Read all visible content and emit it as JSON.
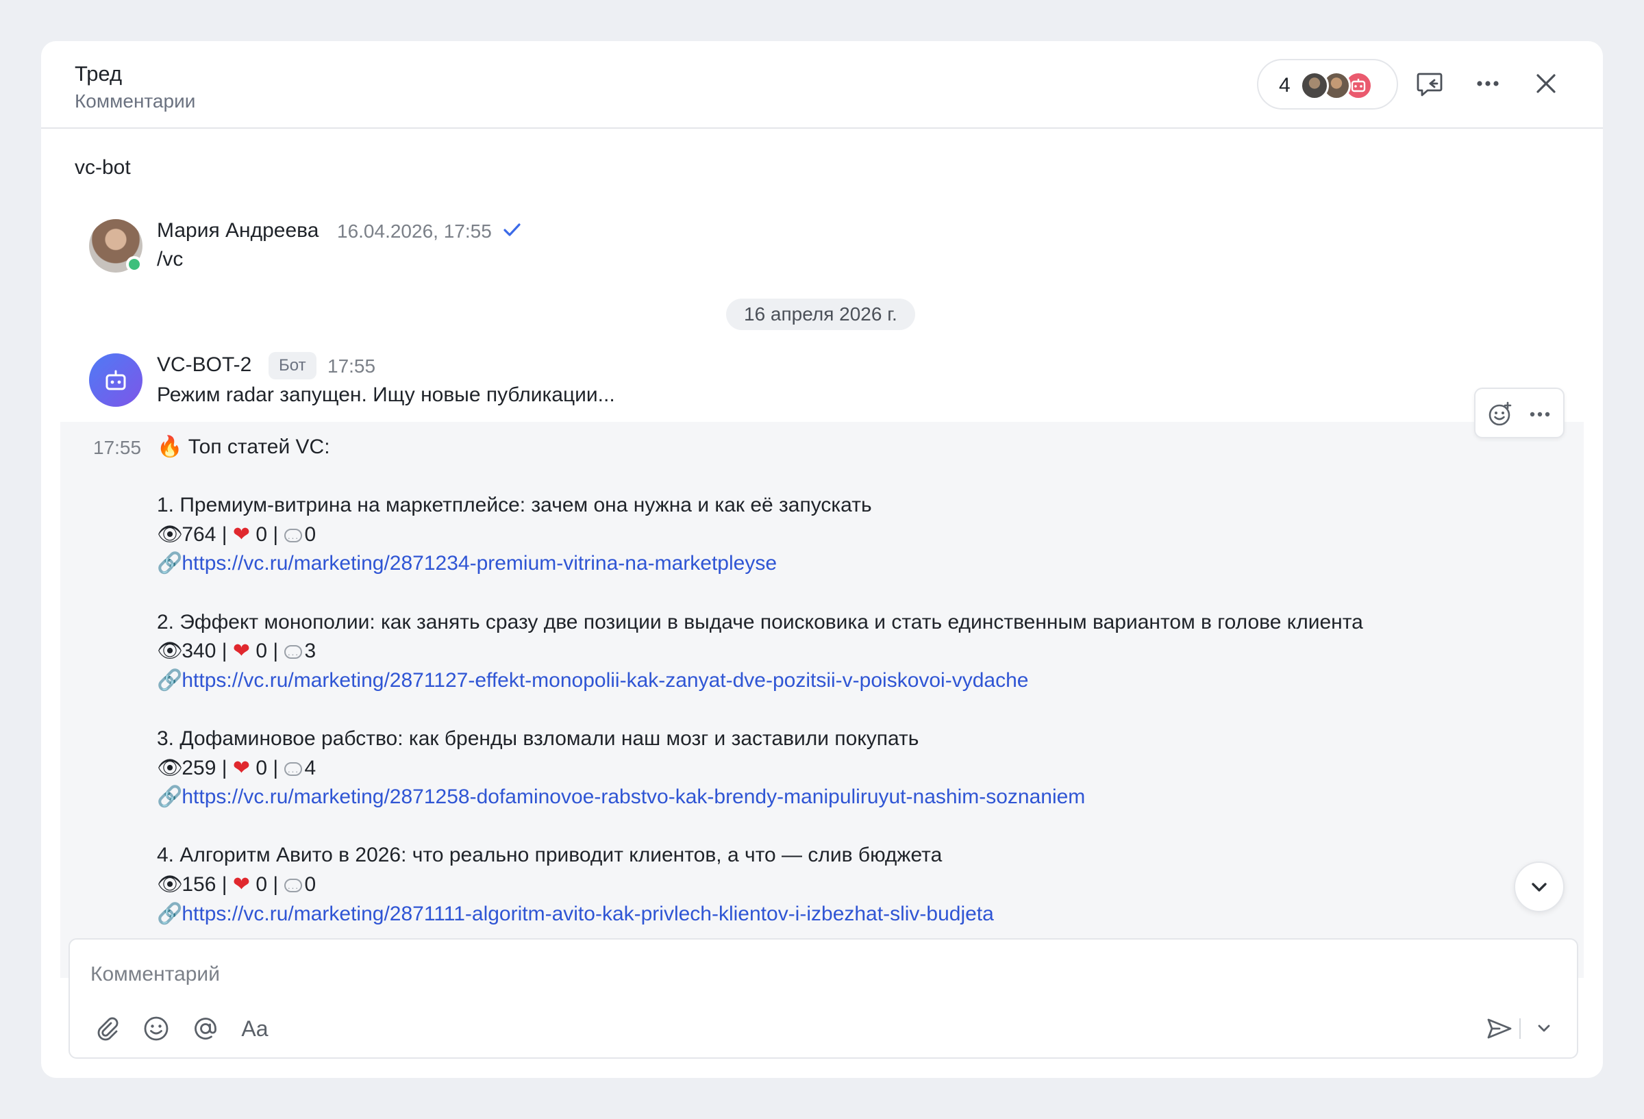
{
  "header": {
    "title": "Тред",
    "subtitle": "Комментарии",
    "members_count": "4"
  },
  "thread": {
    "channel": "vc-bot",
    "date_divider": "16 апреля 2026 г."
  },
  "messages": [
    {
      "author": "Мария Андреева",
      "timestamp": "16.04.2026, 17:55",
      "text": "/vc"
    },
    {
      "author": "VC-BOT-2",
      "badge": "Бот",
      "time": "17:55",
      "text": "Режим radar запущен. Ищу новые публикации..."
    }
  ],
  "post": {
    "time": "17:55",
    "heading": "🔥 Топ статей VC:",
    "articles": [
      {
        "title": "1. Премиум-витрина на маркетплейсе: зачем она нужна и как её запускать",
        "views": "764",
        "likes": "0",
        "comments": "0",
        "url": "https://vc.ru/marketing/2871234-premium-vitrina-na-marketpleyse"
      },
      {
        "title": "2. Эффект монополии: как занять сразу две позиции в выдаче поисковика и стать единственным вариантом в голове клиента",
        "views": "340",
        "likes": "0",
        "comments": "3",
        "url": "https://vc.ru/marketing/2871127-effekt-monopolii-kak-zanyat-dve-pozitsii-v-poiskovoi-vydache"
      },
      {
        "title": "3. Дофаминовое рабство: как бренды взломали наш мозг и заставили покупать",
        "views": "259",
        "likes": "0",
        "comments": "4",
        "url": "https://vc.ru/marketing/2871258-dofaminovoe-rabstvo-kak-brendy-manipuliruyut-nashim-soznaniem"
      },
      {
        "title": "4. Алгоритм Авито в 2026: что реально приводит клиентов, а что — слив бюджета",
        "views": "156",
        "likes": "0",
        "comments": "0",
        "url": "https://vc.ru/marketing/2871111-algoritm-avito-kak-privlech-klientov-i-izbezhat-sliv-budjeta"
      }
    ]
  },
  "composer": {
    "placeholder": "Комментарий",
    "format_label": "Aa"
  },
  "icons": {
    "header": [
      "thread-reply-icon",
      "more-icon",
      "close-icon"
    ],
    "composer": [
      "attach-icon",
      "emoji-icon",
      "mention-icon",
      "send-icon",
      "chevron-down-icon"
    ]
  },
  "colors": {
    "link": "#2f55d4",
    "online": "#3dbf7c",
    "bot_avatar_from": "#4f7bf5",
    "bot_avatar_to": "#7d56e8",
    "check": "#3b6ae8"
  }
}
